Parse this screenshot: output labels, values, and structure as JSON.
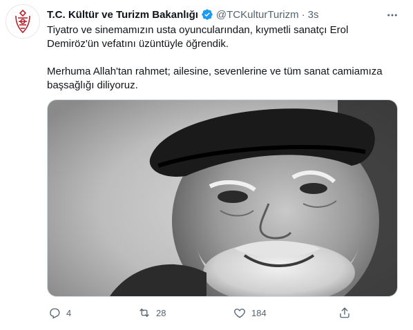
{
  "account": {
    "name": "T.C. Kültür ve Turizm Bakanlığı",
    "handle": "@TCKulturTurizm",
    "separator": "·",
    "time": "3s",
    "avatar_icon": "ministry-seal-icon",
    "verified_color": "#1d9bf0"
  },
  "tweet": {
    "paragraph1": "Tiyatro ve sinemamızın usta oyuncularından, kıymetli sanatçı Erol Demiröz'ün vefatını üzüntüyle öğrendik.",
    "paragraph2": "Merhuma Allah'tan rahmet; ailesine, sevenlerine ve tüm sanat camiamıza başsağlığı diliyoruz."
  },
  "media": {
    "icon": "photo-portrait-icon"
  },
  "actions": {
    "reply_count": "4",
    "retweet_count": "28",
    "like_count": "184"
  },
  "colors": {
    "text": "#0f1419",
    "muted": "#536471",
    "brand_red": "#b5232b"
  }
}
